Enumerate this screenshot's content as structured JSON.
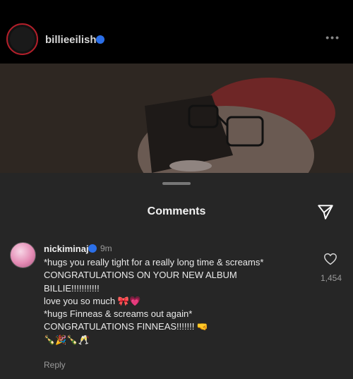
{
  "profile": {
    "username": "billieeilish",
    "more_icon": "more-horizontal-icon"
  },
  "comments_sheet": {
    "title": "Comments",
    "share_icon": "send-icon"
  },
  "comment": {
    "author": "nickiminaj",
    "time": "9m",
    "lines": [
      "*hugs you really tight for a really long time & screams*",
      "CONGRATULATIONS ON YOUR NEW ALBUM",
      "BILLIE!!!!!!!!!!!",
      "love you so much 🎀💗",
      "*hugs Finneas & screams out again*",
      "CONGRATULATIONS FINNEAS!!!!!!! 🤜",
      "🍾🎉🍾🥂"
    ],
    "reply_label": "Reply",
    "like_count": "1,454"
  },
  "colors": {
    "background": "#000000",
    "sheet": "#262626",
    "verified": "#2b6fe8",
    "story_ring": "#b21f2a"
  }
}
